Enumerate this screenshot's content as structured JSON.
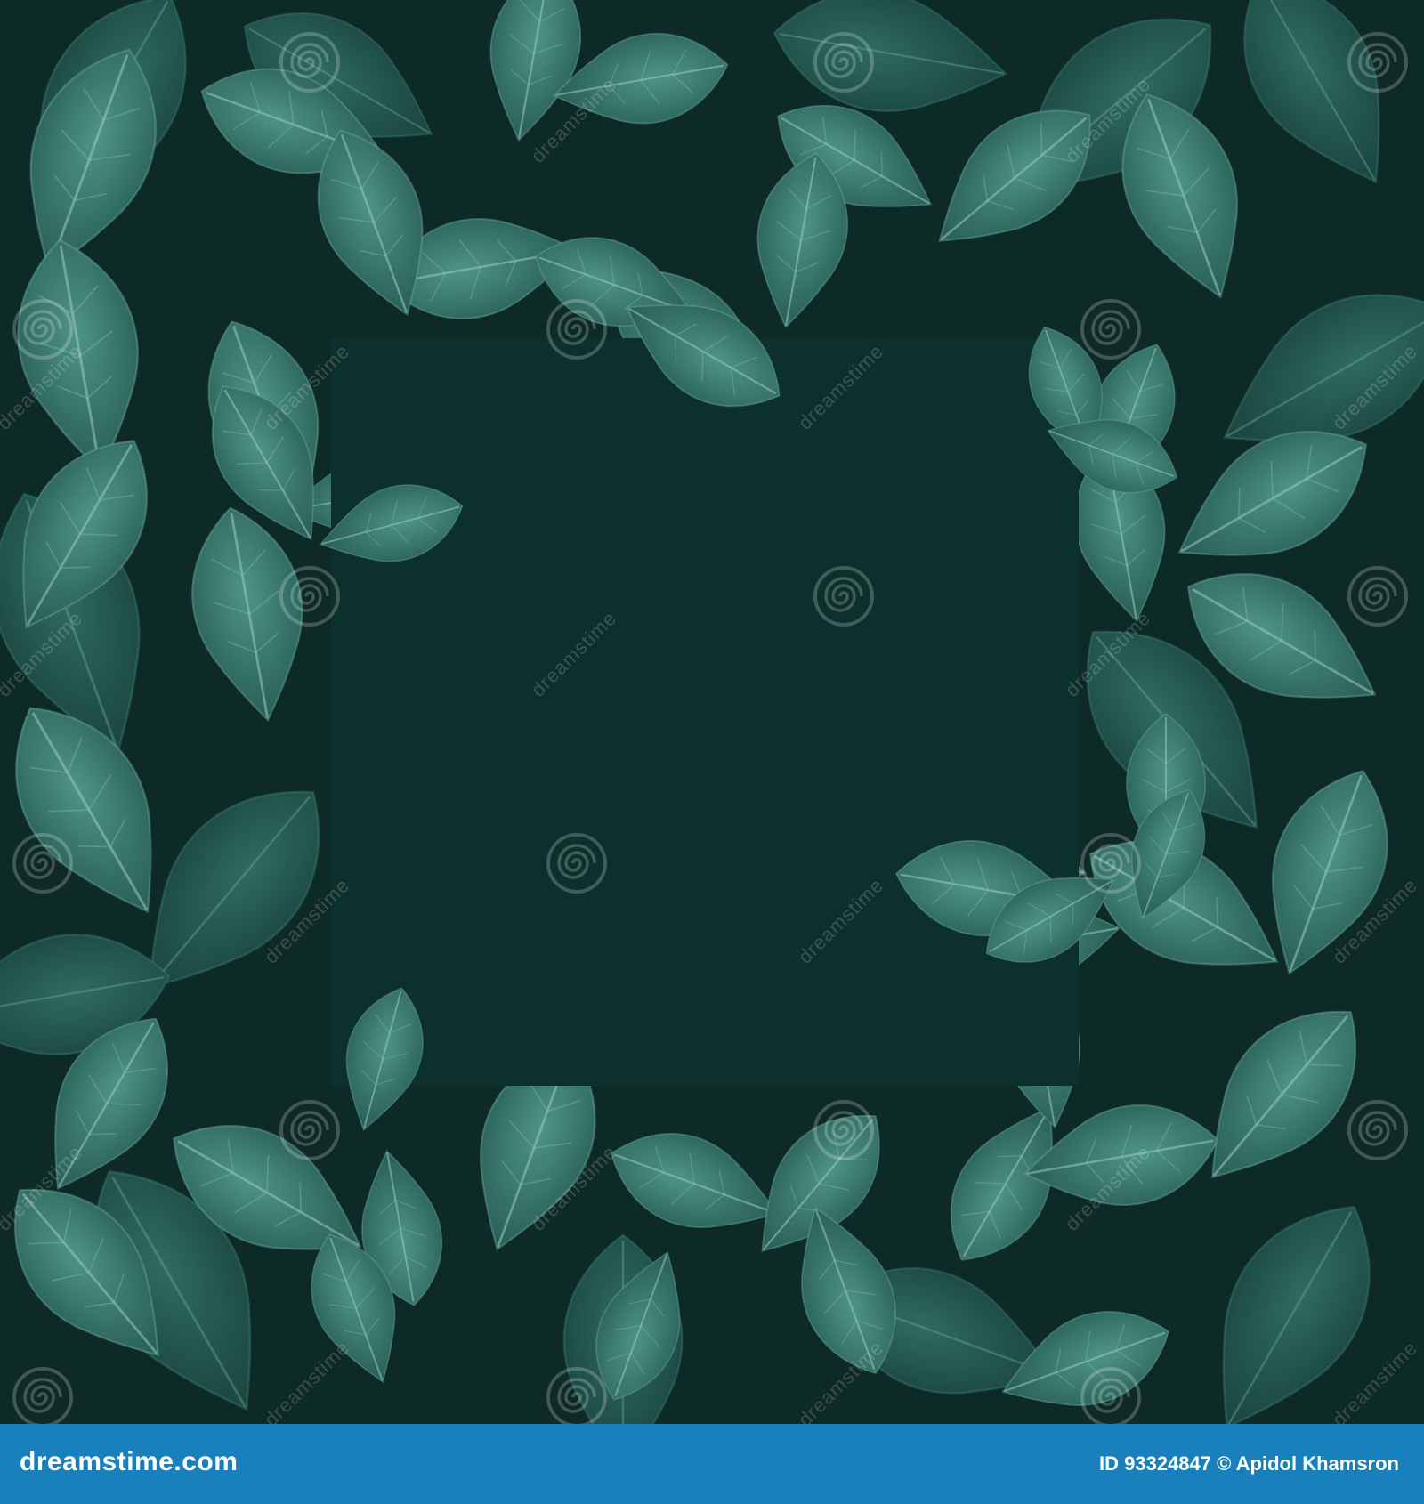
{
  "image": {
    "subject": "dark green leaves framing a blank square",
    "palette": {
      "background": "#0d2a26",
      "leaf_dark": "#1e4f48",
      "leaf_mid": "#2d6b62",
      "leaf_light": "#4a8d82",
      "vein": "#8fc0b6",
      "panel": "#0c302c"
    }
  },
  "watermark": {
    "text": "dreamstime",
    "icon": "spiral-logo"
  },
  "footer": {
    "site": "dreamstime.com",
    "id_label": "ID",
    "id_value": "93324847",
    "copyright_symbol": "©",
    "author": "Apidol Khamsron",
    "background_color": "#1880bd"
  }
}
